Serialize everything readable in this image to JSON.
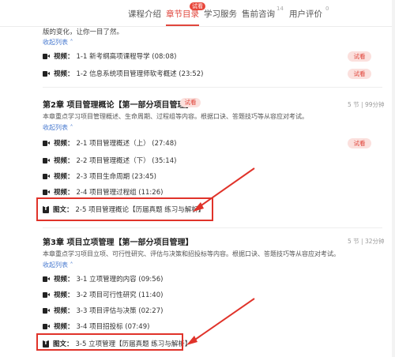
{
  "nav": {
    "tabs": [
      "课程介绍",
      "章节目录",
      "学习服务",
      "售前咨询",
      "用户评价"
    ],
    "active_tab": "章节目录",
    "badge": "试看",
    "consult_count": "14",
    "review_mark": "0"
  },
  "intro_tail": "版的变化，让你一目了然。",
  "collapse_label": "收起列表",
  "try_label": "试看",
  "chapter1_lessons": [
    {
      "kind": "视频：",
      "title": "1-1 新考纲高项课程导学 (08:08)",
      "try": "试看"
    },
    {
      "kind": "视频：",
      "title": "1-2 信息系统项目管理师软考概述 (23:52)",
      "try": "试看"
    }
  ],
  "chapter2": {
    "title": "第2章 项目管理概论【第一部分项目管理】",
    "try": "试看",
    "meta": "5 节 | 99分钟",
    "desc": "本章重点学习项目管理概述、生命周期、过程组等内容。根据口诀、答题技巧等从容应对考试。",
    "collapse": "收起列表",
    "lessons": [
      {
        "kind": "视频：",
        "title": "2-1 项目管理概述（上） (27:48)",
        "try": "试看"
      },
      {
        "kind": "视频：",
        "title": "2-2 项目管理概述（下） (35:14)"
      },
      {
        "kind": "视频：",
        "title": "2-3 项目生命周期 (23:45)"
      },
      {
        "kind": "视频：",
        "title": "2-4 项目管理过程组 (11:26)"
      },
      {
        "kind": "图文：",
        "title": "2-5 项目管理概论【历届真题 练习与解析】"
      }
    ]
  },
  "chapter3": {
    "title": "第3章 项目立项管理【第一部分项目管理】",
    "meta": "5 节 | 32分钟",
    "desc": "本章重点学习项目立项、可行性研究、评估与决策和招投标等内容。根据口诀、答题技巧等从容应对考试。",
    "collapse": "收起列表",
    "lessons": [
      {
        "kind": "视频：",
        "title": "3-1 立项管理的内容 (09:56)"
      },
      {
        "kind": "视频：",
        "title": "3-2 项目可行性研究 (11:40)"
      },
      {
        "kind": "视频：",
        "title": "3-3 项目评估与决策 (02:27)"
      },
      {
        "kind": "视频：",
        "title": "3-4 项目招投标 (07:49)"
      },
      {
        "kind": "图文：",
        "title": "3-5 立项管理【历届真题 练习与解析】"
      }
    ]
  },
  "colors": {
    "accent": "#e0463c",
    "annotation": "#e0332a",
    "link": "#4a7bd0"
  }
}
